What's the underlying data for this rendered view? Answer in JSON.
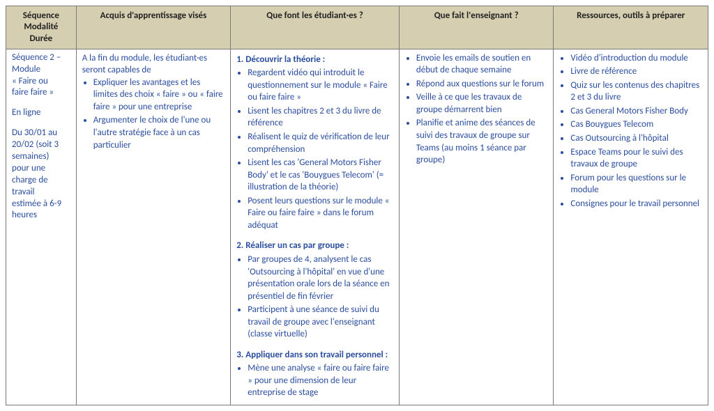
{
  "headers": {
    "col1_l1": "Séquence",
    "col1_l2": "Modalité",
    "col1_l3": "Durée",
    "col2": "Acquis d'apprentissage visés",
    "col3": "Que font les étudiant·es ?",
    "col4": "Que fait l'enseignant ?",
    "col5": "Ressources, outils à préparer"
  },
  "row": {
    "sequence": {
      "l1": "Séquence 2 –",
      "l2": "Module",
      "l3": "« Faire ou",
      "l4": "faire faire »",
      "l5": "En ligne",
      "l6": "Du 30/01 au",
      "l7": "20/02 (soit 3",
      "l8": "semaines)",
      "l9": "pour une",
      "l10": "charge de",
      "l11": "travail",
      "l12": "estimée à 6-9",
      "l13": "heures"
    },
    "outcomes": {
      "lead": "A la fin du module, les étudiant·es seront capables de",
      "items": [
        "Expliquer les avantages et les limites des choix « faire » ou « faire faire » pour une entreprise",
        "Argumenter le choix de l'une ou l'autre stratégie face à un cas particulier"
      ]
    },
    "students": {
      "s1_title": "1. Découvrir la théorie :",
      "s1_items": [
        "Regardent vidéo qui introduit le questionnement sur le module « Faire ou faire faire »",
        "Lisent les chapitres 2 et 3 du livre de référence",
        "Réalisent le quiz de vérification de leur compréhension",
        "Lisent les cas 'General Motors Fisher Body' et le cas 'Bouygues Telecom' (= illustration de la théorie)",
        "Posent leurs questions sur le module « Faire ou faire faire » dans le forum adéquat"
      ],
      "s2_title": "2. Réaliser un cas par groupe :",
      "s2_items": [
        "Par groupes de 4, analysent le cas 'Outsourcing à l'hôpital' en vue d'une présentation orale lors de la séance en présentiel de fin février",
        "Participent à une séance de suivi du travail de groupe avec l'enseignant (classe virtuelle)"
      ],
      "s3_title": "3. Appliquer dans son travail personnel :",
      "s3_items": [
        "Mène une analyse « faire ou faire faire » pour une dimension de leur entreprise de stage"
      ]
    },
    "teacher": {
      "items": [
        "Envoie les emails de soutien en début de chaque semaine",
        "Répond aux questions sur le forum",
        "Veille à ce que les travaux de groupe démarrent bien",
        "Planifie et anime des séances de suivi des travaux de groupe sur Teams (au moins 1 séance par groupe)"
      ]
    },
    "resources": {
      "items": [
        "Vidéo d'introduction du module",
        "Livre de référence",
        "Quiz sur les contenus des chapitres 2 et 3 du livre",
        "Cas General Motors Fisher Body",
        "Cas Bouygues Telecom",
        "Cas Outsourcing à l'hôpital",
        "Espace Teams pour le suivi des travaux de groupe",
        "Forum pour les questions sur le module",
        "Consignes pour le travail personnel"
      ]
    }
  }
}
